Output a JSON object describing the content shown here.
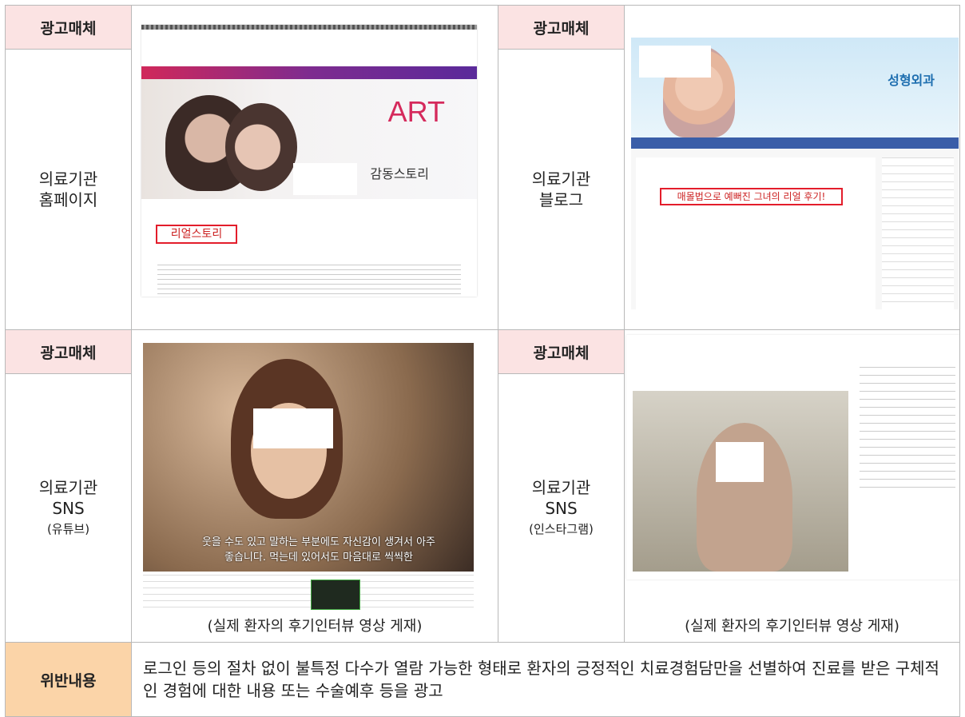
{
  "ad_media_header": "광고매체",
  "rows": [
    {
      "left_label": [
        "의료기관",
        "홈페이지"
      ],
      "right_label": [
        "의료기관",
        "블로그"
      ]
    },
    {
      "left_label": [
        "의료기관",
        "SNS",
        "(유튜브)"
      ],
      "right_label": [
        "의료기관",
        "SNS",
        "(인스타그램)"
      ]
    }
  ],
  "homepage_shot": {
    "brand": "ART",
    "heading": "감동스토리",
    "boxed_text": "리얼스토리"
  },
  "blog_shot": {
    "blog_title": "성형외과",
    "post_title": "매몰법으로 예뻐진 그녀의 리얼 후기!"
  },
  "youtube_shot": {
    "subtitle": "웃을 수도 있고 말하는 부분에도 자신감이 생겨서 아주 좋습니다. 먹는데 있어서도 마음대로 씩씩한"
  },
  "captions": {
    "youtube": "(실제 환자의 후기인터뷰 영상 게재)",
    "instagram": "(실제 환자의 후기인터뷰 영상 게재)"
  },
  "violation": {
    "header": "위반내용",
    "text": "로그인 등의 절차 없이 불특정 다수가 열람 가능한 형태로 환자의 긍정적인 치료경험담만을 선별하여 진료를 받은 구체적인 경험에 대한 내용 또는 수술예후 등을 광고"
  }
}
